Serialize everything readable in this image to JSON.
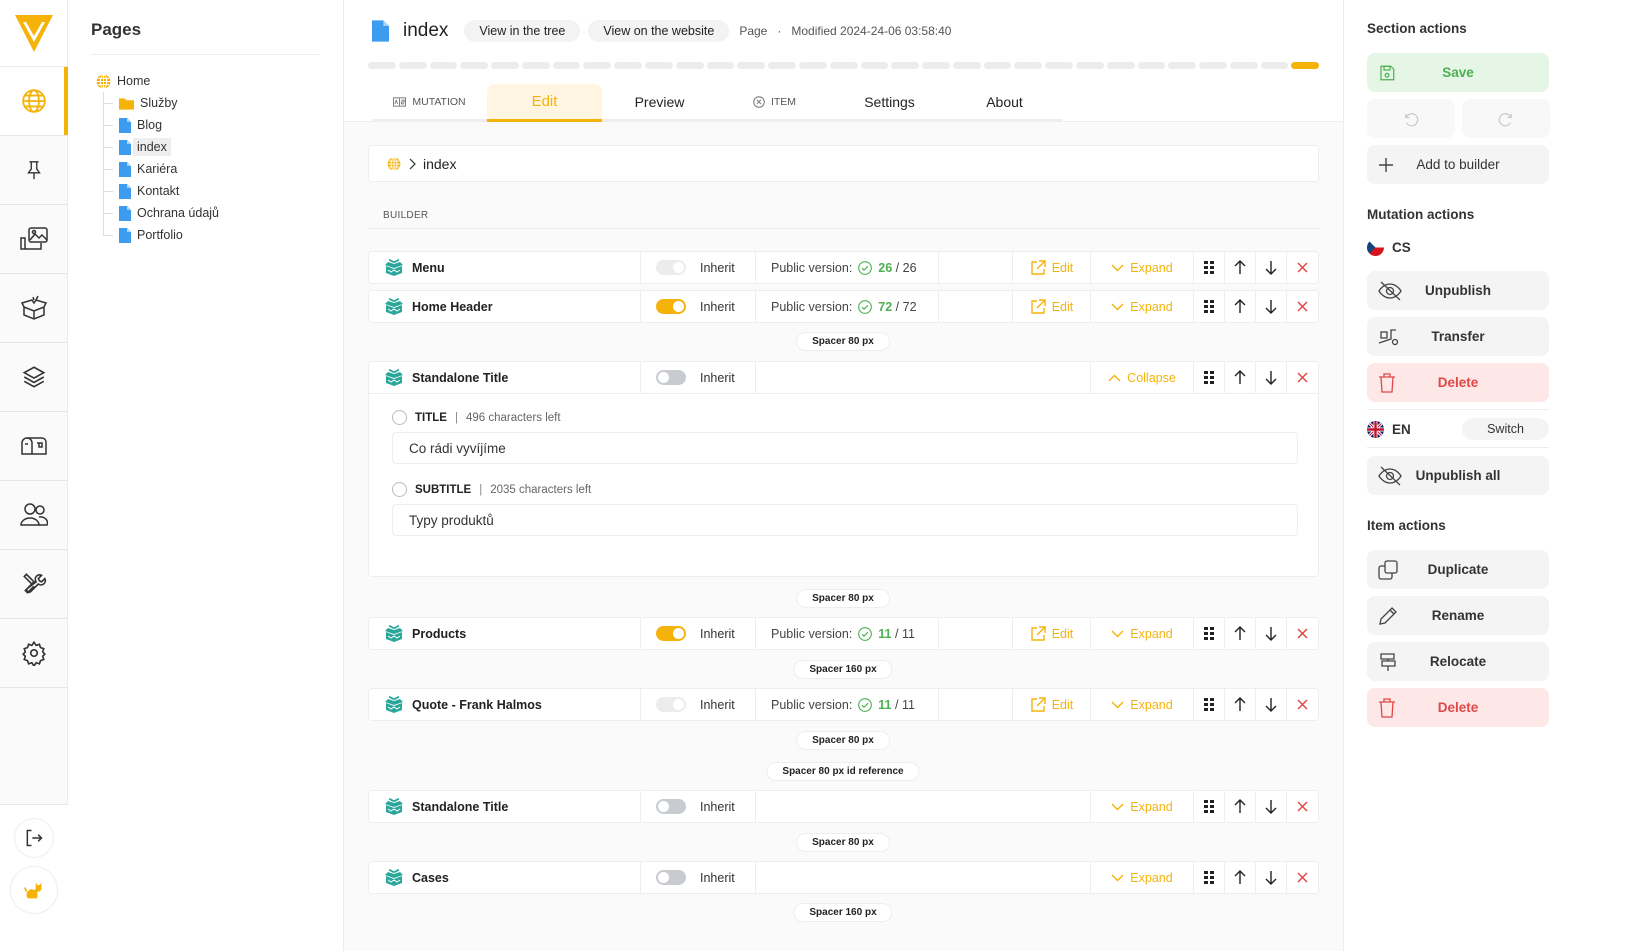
{
  "rail": {
    "items": [
      {
        "icon": "globe-icon",
        "active": true
      },
      {
        "icon": "pin-icon"
      },
      {
        "icon": "media-gallery-icon"
      },
      {
        "icon": "open-box-icon"
      },
      {
        "icon": "layers-icon"
      },
      {
        "icon": "mailbox-icon"
      },
      {
        "icon": "users-icon"
      },
      {
        "icon": "tools-icon"
      },
      {
        "icon": "gear-icon"
      }
    ],
    "bottom": [
      "logout-icon",
      "cat-avatar-icon"
    ]
  },
  "pages": {
    "title": "Pages",
    "root": "Home",
    "children": [
      {
        "label": "Služby",
        "type": "folder"
      },
      {
        "label": "Blog",
        "type": "page"
      },
      {
        "label": "index",
        "type": "page",
        "selected": true
      },
      {
        "label": "Kariéra",
        "type": "page"
      },
      {
        "label": "Kontakt",
        "type": "page"
      },
      {
        "label": "Ochrana údajů",
        "type": "page"
      },
      {
        "label": "Portfolio",
        "type": "page"
      }
    ]
  },
  "header": {
    "title": "index",
    "view_tree": "View in the tree",
    "view_site": "View on the website",
    "type": "Page",
    "separator": "·",
    "modified": "Modified 2024-24-06 03:58:40",
    "progress": {
      "segments": 31,
      "active_segment": 31
    }
  },
  "tabs": [
    {
      "label": "MUTATION",
      "small": true,
      "icon": "translate-icon"
    },
    {
      "label": "Edit",
      "active": true
    },
    {
      "label": "Preview"
    },
    {
      "label": "ITEM",
      "small": true,
      "icon": "item-icon"
    },
    {
      "label": "Settings"
    },
    {
      "label": "About"
    }
  ],
  "breadcrumb": {
    "current": "index"
  },
  "builder": {
    "label": "BUILDER",
    "inherit_label": "Inherit",
    "public_version_label": "Public version:",
    "edit_label": "Edit",
    "expand_label": "Expand",
    "collapse_label": "Collapse",
    "blocks": [
      {
        "name": "Menu",
        "toggle": "disabled",
        "version": {
          "published": "26",
          "total": "26"
        },
        "edit": true,
        "state": "Expand"
      },
      {
        "name": "Home Header",
        "toggle": "on",
        "version": {
          "published": "72",
          "total": "72"
        },
        "edit": true,
        "state": "Expand"
      },
      {
        "name": "Standalone Title",
        "toggle": "off",
        "state": "Collapse",
        "fields": [
          {
            "name": "TITLE",
            "left": "496 characters left",
            "value": "Co rádi vyvíjíme"
          },
          {
            "name": "SUBTITLE",
            "left": "2035 characters left",
            "value": "Typy produktů"
          }
        ]
      },
      {
        "name": "Products",
        "toggle": "on",
        "version": {
          "published": "11",
          "total": "11"
        },
        "edit": true,
        "state": "Expand"
      },
      {
        "name": "Quote - Frank Halmos",
        "toggle": "disabled",
        "version": {
          "published": "11",
          "total": "11"
        },
        "edit": true,
        "state": "Expand"
      },
      {
        "name": "Standalone Title",
        "toggle": "off",
        "state": "Expand"
      },
      {
        "name": "Cases",
        "toggle": "off",
        "state": "Expand"
      }
    ],
    "spacers": [
      "Spacer 80 px",
      "Spacer 80 px",
      "Spacer 160 px",
      "Spacer 80 px",
      "Spacer 80 px id reference",
      "Spacer 80 px",
      "Spacer 160 px"
    ]
  },
  "actions": {
    "section_title": "Section actions",
    "save": "Save",
    "add_to_builder": "Add to builder",
    "mutation_title": "Mutation actions",
    "lang_cs": "CS",
    "unpublish": "Unpublish",
    "transfer": "Transfer",
    "delete": "Delete",
    "lang_en": "EN",
    "switch": "Switch",
    "unpublish_all": "Unpublish all",
    "item_title": "Item actions",
    "duplicate": "Duplicate",
    "rename": "Rename",
    "relocate": "Relocate",
    "item_delete": "Delete"
  },
  "colors": {
    "accent": "#f5b30a",
    "success": "#4caf50",
    "danger": "#e04848",
    "block_icon": "#2aa69a"
  }
}
